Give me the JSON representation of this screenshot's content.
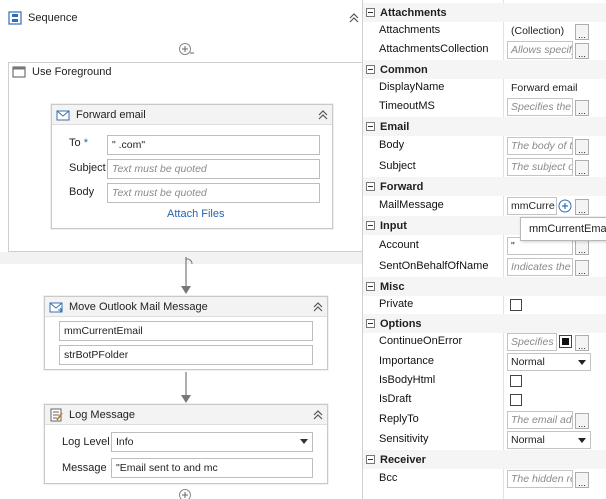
{
  "designer": {
    "sequence": {
      "title": "Sequence"
    },
    "use_foreground": {
      "title": "Use Foreground"
    },
    "forward_email": {
      "title": "Forward email",
      "to_label": "To",
      "required_mark": "*",
      "to_value": "\"                                  .com\"",
      "subject_label": "Subject",
      "subject_placeholder": "Text must be quoted",
      "body_label": "Body",
      "body_placeholder": "Text must be quoted",
      "attach_link": "Attach Files"
    },
    "move_mail": {
      "title": "Move Outlook Mail Message",
      "mail_value": "mmCurrentEmail",
      "folder_value": "strBotPFolder"
    },
    "log_message": {
      "title": "Log Message",
      "level_label": "Log Level",
      "level_value": "Info",
      "message_label": "Message",
      "message_value": "\"Email sent to                              and mc"
    }
  },
  "properties": {
    "categories": {
      "attachments": "Attachments",
      "common": "Common",
      "email": "Email",
      "forward": "Forward",
      "input": "Input",
      "misc": "Misc",
      "options": "Options",
      "receiver": "Receiver"
    },
    "rows": {
      "attachments": {
        "name": "Attachments",
        "value": "(Collection)"
      },
      "attachments_collection": {
        "name": "AttachmentsCollection",
        "placeholder": "Allows specify"
      },
      "display_name": {
        "name": "DisplayName",
        "value": "Forward email"
      },
      "timeout": {
        "name": "TimeoutMS",
        "placeholder": "Specifies the a"
      },
      "body": {
        "name": "Body",
        "placeholder": "The body of th"
      },
      "subject": {
        "name": "Subject",
        "placeholder": "The subject of"
      },
      "mail_message": {
        "name": "MailMessage",
        "value": "mmCurre"
      },
      "account": {
        "name": "Account",
        "value": "\""
      },
      "sent_on_behalf": {
        "name": "SentOnBehalfOfName",
        "placeholder": "Indicates the e"
      },
      "private": {
        "name": "Private"
      },
      "continue_on_error": {
        "name": "ContinueOnError",
        "placeholder": "Specifies t"
      },
      "importance": {
        "name": "Importance",
        "value": "Normal"
      },
      "is_body_html": {
        "name": "IsBodyHtml"
      },
      "is_draft": {
        "name": "IsDraft"
      },
      "reply_to": {
        "name": "ReplyTo",
        "placeholder": "The email addr"
      },
      "sensitivity": {
        "name": "Sensitivity",
        "value": "Normal"
      },
      "bcc": {
        "name": "Bcc",
        "placeholder": "The hidden re"
      }
    },
    "ellipsis": "...",
    "tooltip": "mmCurrentEmail"
  },
  "colors": {
    "accent_link": "#2464b4",
    "required": "#2464b4",
    "category_bg": "#f5f5f5"
  }
}
